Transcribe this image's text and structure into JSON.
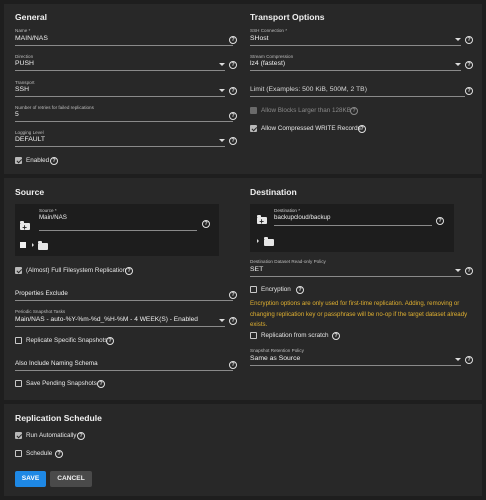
{
  "general": {
    "title": "General",
    "name": {
      "label": "Name *",
      "value": "MAIN/NAS"
    },
    "direction": {
      "label": "Direction",
      "value": "PUSH"
    },
    "transport": {
      "label": "Transport",
      "value": "SSH"
    },
    "retries": {
      "label": "Number of retries for failed replications",
      "value": "5"
    },
    "logging": {
      "label": "Logging Level",
      "value": "DEFAULT"
    },
    "enabled": {
      "label": "Enabled",
      "checked": true
    }
  },
  "transport_options": {
    "title": "Transport Options",
    "ssh": {
      "label": "SSH Connection *",
      "value": "SHost"
    },
    "compression": {
      "label": "Stream Compression",
      "value": "lz4 (fastest)"
    },
    "limit": {
      "placeholder": "Limit (Examples: 500 KiB, 500M, 2 TB)"
    },
    "allow_large": {
      "label": "Allow Blocks Larger than 128KB",
      "checked": true,
      "disabled": true
    },
    "allow_compressed": {
      "label": "Allow Compressed WRITE Records",
      "checked": true
    }
  },
  "source": {
    "title": "Source",
    "path_label": "Source *",
    "path_value": "Main/NAS",
    "full_fs": {
      "label": "(Almost) Full Filesystem Replication",
      "checked": true
    },
    "properties_exclude": {
      "placeholder": "Properties Exclude"
    },
    "periodic": {
      "label": "Periodic Snapshot Tasks",
      "value": "Main/NAS - auto-%Y-%m-%d_%H-%M - 4 WEEK(S) - Enabled"
    },
    "replicate_specific": {
      "label": "Replicate Specific Snapshots",
      "checked": false
    },
    "naming_schema": {
      "placeholder": "Also Include Naming Schema"
    },
    "save_pending": {
      "label": "Save Pending Snapshots",
      "checked": false
    }
  },
  "destination": {
    "title": "Destination",
    "path_label": "Destination *",
    "path_value": "backupcloud/backup",
    "readonly": {
      "label": "Destination Dataset Read-only Policy",
      "value": "SET"
    },
    "encryption": {
      "label": "Encryption",
      "checked": false
    },
    "encryption_hint": "Encryption options are only used for first-time replication. Adding, removing or changing replication key or passphrase will be no-op if the target dataset already exists.",
    "from_scratch": {
      "label": "Replication from scratch",
      "checked": false
    },
    "retention": {
      "label": "Snapshot Retention Policy",
      "value": "Same as Source"
    }
  },
  "schedule": {
    "title": "Replication Schedule",
    "run_auto": {
      "label": "Run Automatically",
      "checked": true
    },
    "schedule": {
      "label": "Schedule",
      "checked": false
    }
  },
  "actions": {
    "save": "SAVE",
    "cancel": "CANCEL"
  },
  "colors": {
    "primary": "#1e88e5",
    "hint": "#e0b030",
    "panel": "#282828",
    "background": "#1e1e1e"
  },
  "icons": {
    "help": "?"
  }
}
